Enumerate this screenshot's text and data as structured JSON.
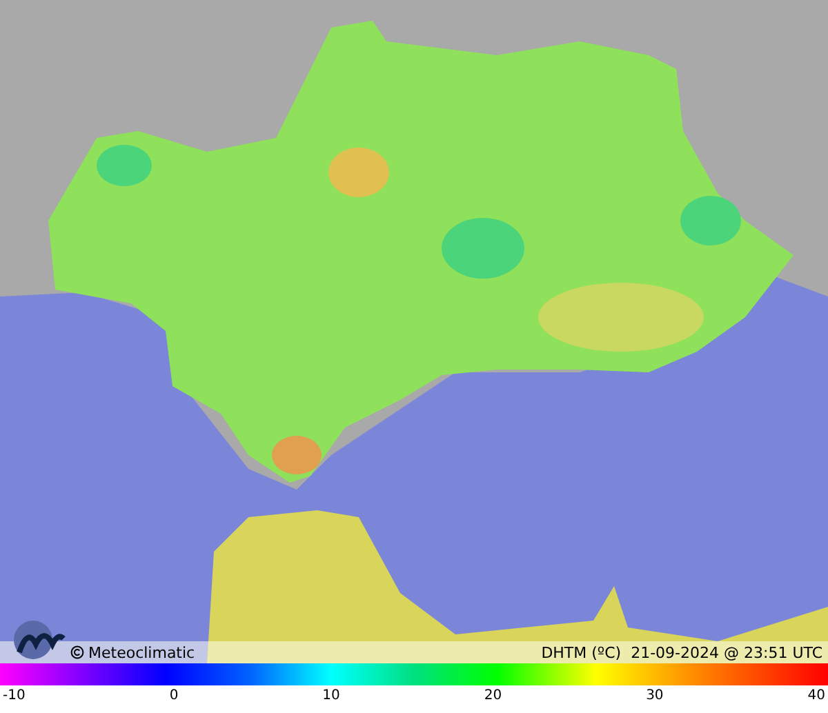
{
  "map": {
    "brand": "Meteoclimatic",
    "caption": "DHTM (ºC)  21-09-2024 @ 23:51 UTC"
  },
  "scale": {
    "ticks": [
      "-10",
      "0",
      "10",
      "20",
      "30",
      "40"
    ]
  }
}
